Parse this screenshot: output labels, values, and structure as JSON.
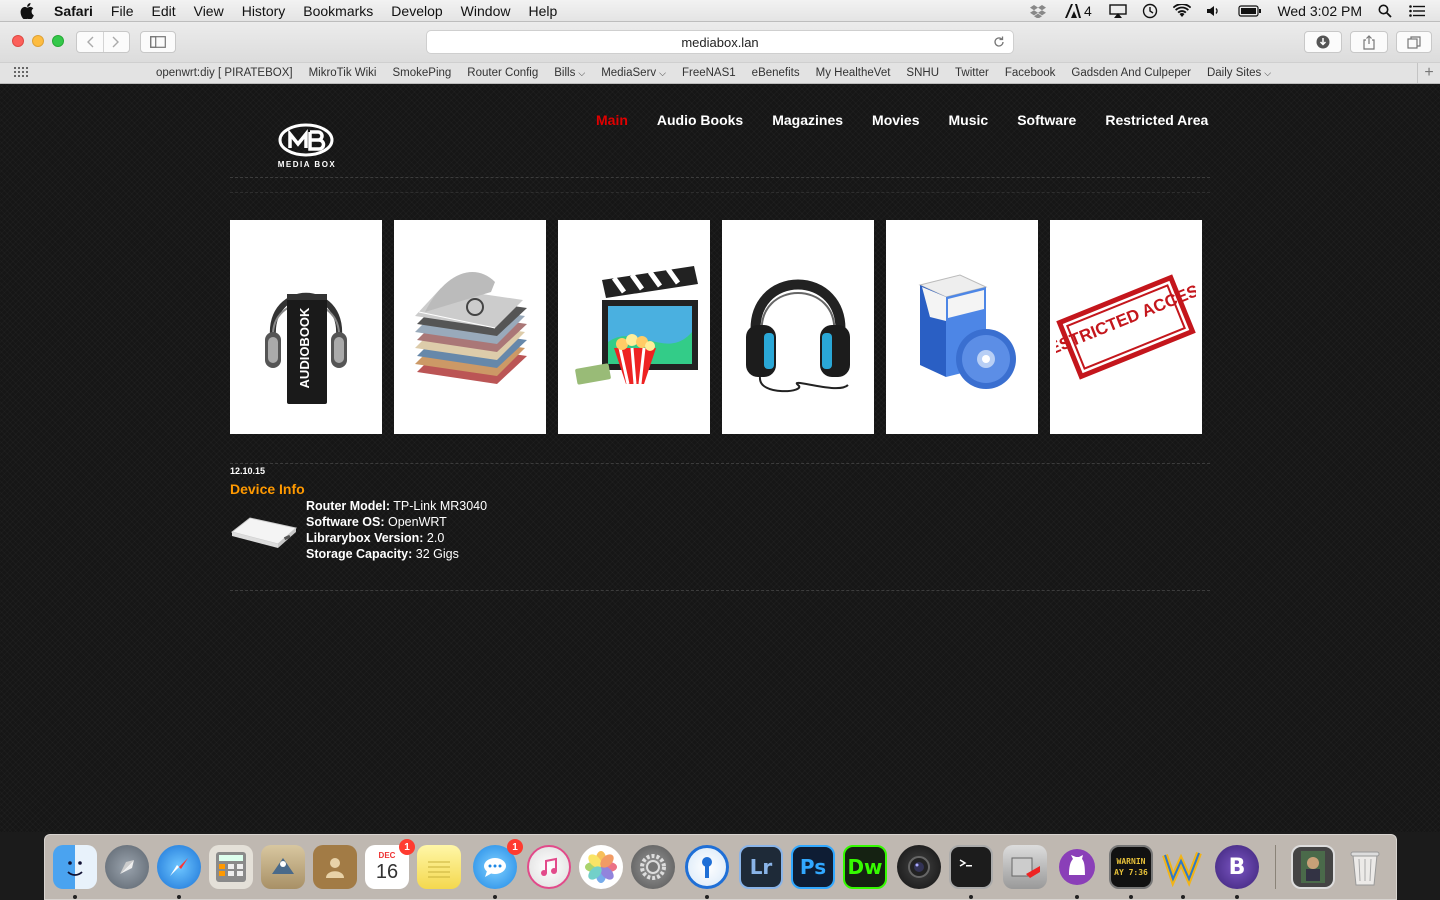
{
  "menubar": {
    "app_name": "Safari",
    "items": [
      "File",
      "Edit",
      "View",
      "History",
      "Bookmarks",
      "Develop",
      "Window",
      "Help"
    ],
    "status_count": "4",
    "clock": "Wed 3:02 PM"
  },
  "toolbar": {
    "url": "mediabox.lan"
  },
  "favorites": [
    {
      "label": "openwrt:diy [ PIRATEBOX]",
      "menu": false
    },
    {
      "label": "MikroTik Wiki",
      "menu": false
    },
    {
      "label": "SmokePing",
      "menu": false
    },
    {
      "label": "Router Config",
      "menu": false
    },
    {
      "label": "Bills",
      "menu": true
    },
    {
      "label": "MediaServ",
      "menu": true
    },
    {
      "label": "FreeNAS1",
      "menu": false
    },
    {
      "label": "eBenefits",
      "menu": false
    },
    {
      "label": "My HealtheVet",
      "menu": false
    },
    {
      "label": "SNHU",
      "menu": false
    },
    {
      "label": "Twitter",
      "menu": false
    },
    {
      "label": "Facebook",
      "menu": false
    },
    {
      "label": "Gadsden And Culpeper",
      "menu": false
    },
    {
      "label": "Daily Sites",
      "menu": true
    }
  ],
  "site": {
    "logo_text": "MEDIA BOX",
    "nav": [
      {
        "label": "Main",
        "active": true
      },
      {
        "label": "Audio Books",
        "active": false
      },
      {
        "label": "Magazines",
        "active": false
      },
      {
        "label": "Movies",
        "active": false
      },
      {
        "label": "Music",
        "active": false
      },
      {
        "label": "Software",
        "active": false
      },
      {
        "label": "Restricted Area",
        "active": false
      }
    ],
    "tiles": [
      {
        "name": "audiobooks",
        "image_text": "AUDIOBOOK"
      },
      {
        "name": "magazines",
        "image_text": ""
      },
      {
        "name": "movies",
        "image_text": ""
      },
      {
        "name": "music",
        "image_text": ""
      },
      {
        "name": "software",
        "image_text": ""
      },
      {
        "name": "restricted",
        "image_text": "RESTRICTED ACCESS"
      }
    ],
    "post": {
      "date": "12.10.15",
      "title": "Device Info",
      "fields": [
        {
          "label": "Router Model:",
          "value": "TP-Link MR3040"
        },
        {
          "label": "Software OS:",
          "value": "OpenWRT"
        },
        {
          "label": "Librarybox Version:",
          "value": "2.0"
        },
        {
          "label": "Storage Capacity:",
          "value": "32 Gigs"
        }
      ]
    }
  },
  "dock": {
    "calendar_month": "DEC",
    "calendar_day": "16",
    "calendar_badge": "1",
    "messages_badge": "1",
    "apps": [
      "Finder",
      "Launchpad",
      "Safari",
      "Calculator",
      "Mail",
      "Contacts",
      "Calendar",
      "Notes",
      "Messages",
      "iTunes",
      "Photos",
      "System Preferences",
      "1Password",
      "Lightroom",
      "Photoshop",
      "Dreamweaver",
      "Photo Booth",
      "Terminal",
      "Utility",
      "GitHub",
      "Console",
      "Wunderground",
      "BBEdit",
      "Downloads",
      "Trash"
    ],
    "icon_text": {
      "lightroom": "Lr",
      "photoshop": "Ps",
      "dreamweaver": "Dw",
      "console": "WARNIN AY 7:36",
      "bbedit": "B"
    }
  },
  "colors": {
    "nav_active": "#e00000",
    "post_title": "#ff9900",
    "page_bg": "#161616"
  }
}
